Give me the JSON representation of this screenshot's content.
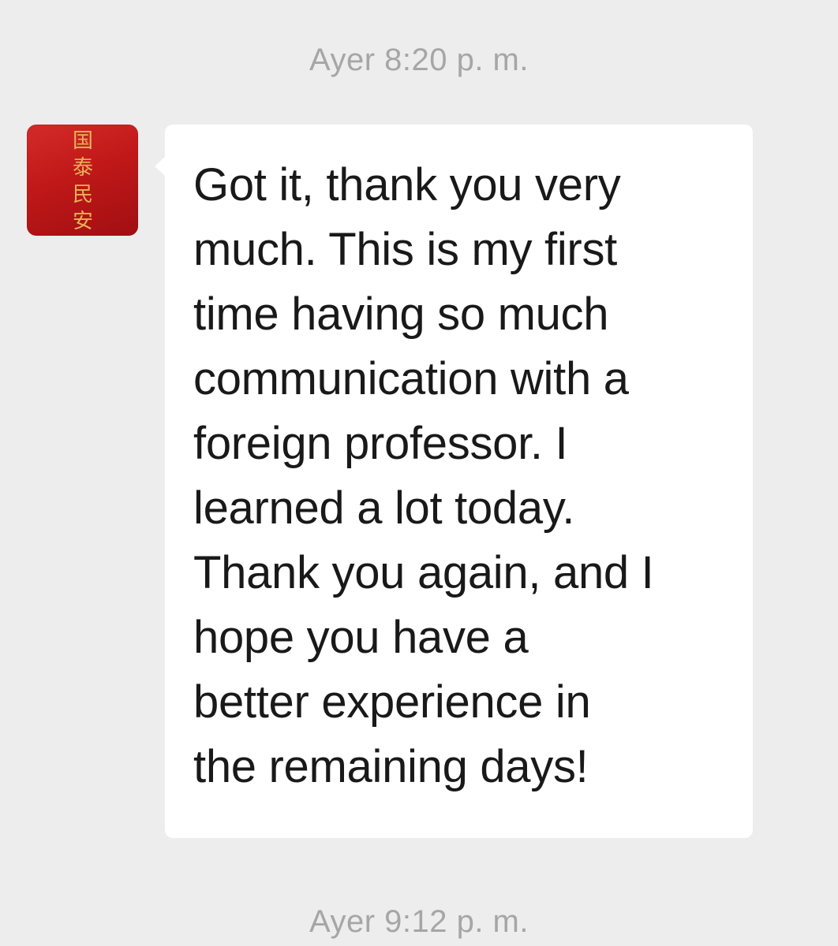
{
  "chat": {
    "timestamp_top": "Ayer 8:20 p. m.",
    "timestamp_bottom": "Ayer 9:12 p. m.",
    "message": {
      "text": "Got it, thank you very\nmuch. This is my first\ntime having so much\ncommunication with a\nforeign professor. I\nlearned a lot today.\nThank you again, and I\nhope you have a\nbetter experience in\nthe remaining days!"
    },
    "avatar": {
      "characters": [
        "国",
        "泰",
        "民",
        "安"
      ],
      "background_color": "#c01818",
      "text_color": "#e7b25a"
    }
  },
  "colors": {
    "background": "#ededed",
    "bubble": "#ffffff",
    "timestamp": "#a6a6a6",
    "message_text": "#191919"
  }
}
